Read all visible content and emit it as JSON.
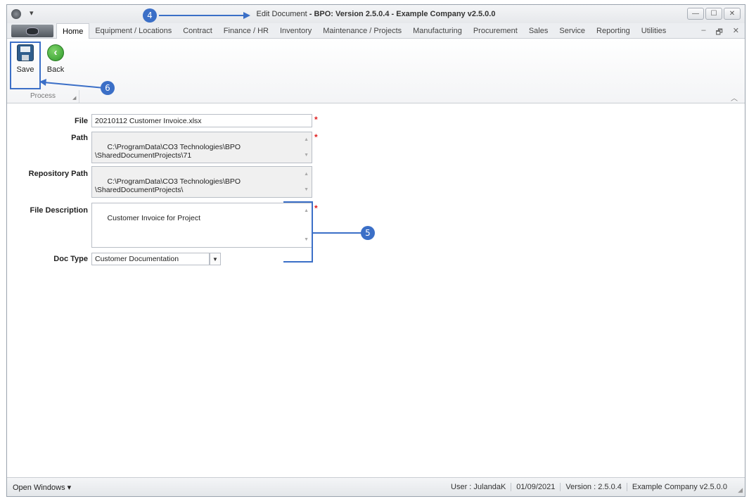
{
  "window": {
    "title_prefix": "Edit Document",
    "title_main": " - BPO: Version 2.5.0.4 - Example Company v2.5.0.0",
    "buttons": [
      "—",
      "☐",
      "✕"
    ]
  },
  "tabs": [
    "Home",
    "Equipment / Locations",
    "Contract",
    "Finance / HR",
    "Inventory",
    "Maintenance / Projects",
    "Manufacturing",
    "Procurement",
    "Sales",
    "Service",
    "Reporting",
    "Utilities"
  ],
  "mdi_controls": [
    "–",
    "🗗",
    "✕"
  ],
  "ribbon": {
    "save_label": "Save",
    "back_label": "Back",
    "group_label": "Process"
  },
  "form": {
    "file_label": "File",
    "file_value": "20210112 Customer Invoice.xlsx",
    "path_label": "Path",
    "path_value": "C:\\ProgramData\\CO3 Technologies\\BPO\n\\SharedDocumentProjects\\71",
    "repo_label": "Repository Path",
    "repo_value": "C:\\ProgramData\\CO3 Technologies\\BPO\n\\SharedDocumentProjects\\",
    "desc_label": "File Description",
    "desc_value": "Customer Invoice for Project",
    "doctype_label": "Doc Type",
    "doctype_value": "Customer Documentation",
    "required_mark": "*"
  },
  "statusbar": {
    "open_windows": "Open Windows ▾",
    "user": "User : JulandaK",
    "date": "01/09/2021",
    "version": "Version : 2.5.0.4",
    "company": "Example Company v2.5.0.0"
  },
  "callouts": {
    "title": "4",
    "fields": "5",
    "save": "6"
  },
  "colors": {
    "callout": "#3b6fc7",
    "required": "#e02020"
  }
}
